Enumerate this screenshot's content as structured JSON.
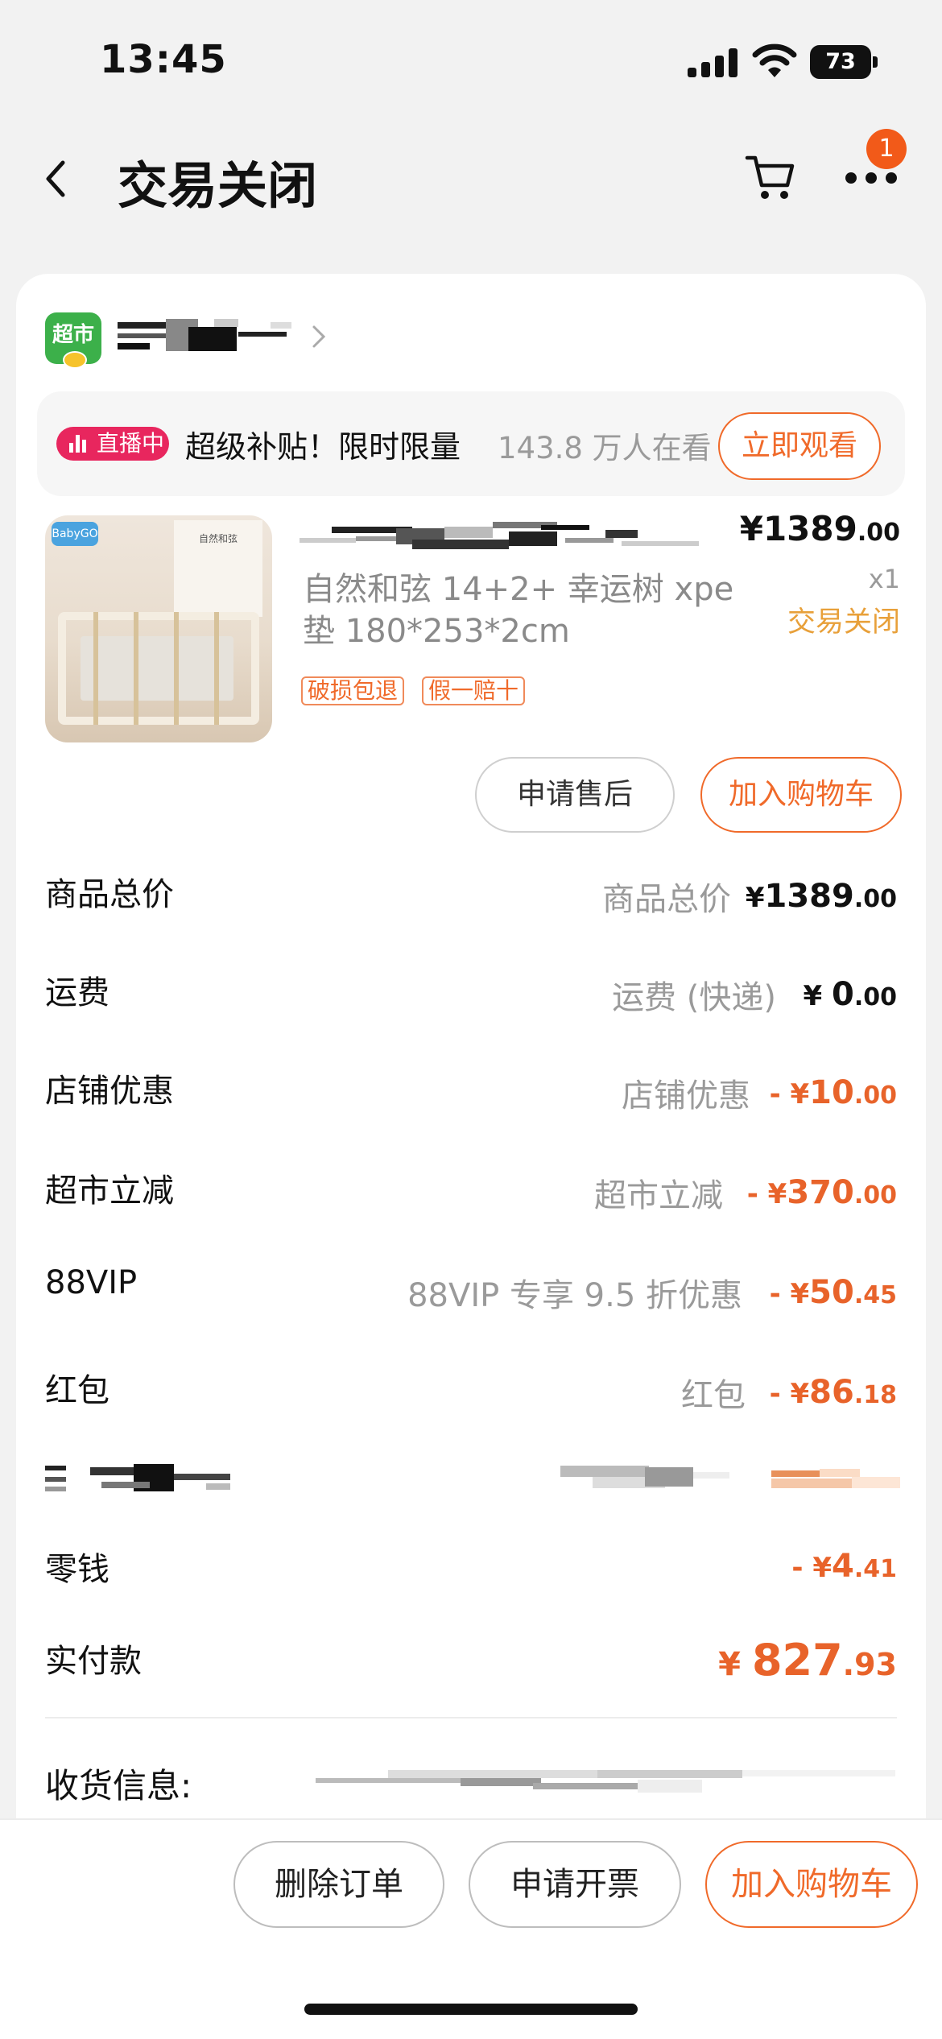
{
  "status_bar": {
    "time": "13:45",
    "battery": "73"
  },
  "nav": {
    "title": "交易关闭",
    "badge_count": "1"
  },
  "shop": {
    "market_logo_text": "超市"
  },
  "live": {
    "badge": "直播中",
    "text": "超级补贴！限时限量",
    "viewers": "143.8 万人在看",
    "watch_button": "立即观看"
  },
  "product": {
    "brand_mark": "BabyGO",
    "image_sign": "自然和弦",
    "desc": "自然和弦 14+2+ 幸运树 xpe 垫 180*253*2cm",
    "tags": [
      "破损包退",
      "假一赔十"
    ],
    "price_symbol": "¥",
    "price_int": "1389",
    "price_dec": ".00",
    "qty": "x1",
    "status": "交易关闭",
    "after_sale_button": "申请售后",
    "add_cart_button": "加入购物车"
  },
  "rows": {
    "total": {
      "label": "商品总价",
      "sub": "商品总价",
      "prefix": "¥",
      "int": "1389",
      "dec": ".00"
    },
    "shipping": {
      "label": "运费",
      "sub": "运费 (快递)",
      "prefix": "¥ ",
      "int": "0",
      "dec": ".00"
    },
    "shop_discount": {
      "label": "店铺优惠",
      "sub": "店铺优惠",
      "prefix": "- ¥",
      "int": "10",
      "dec": ".00"
    },
    "market_discount": {
      "label": "超市立减",
      "sub": "超市立减",
      "prefix": "- ¥",
      "int": "370",
      "dec": ".00"
    },
    "vip": {
      "label": "88VIP",
      "sub": "88VIP 专享 9.5 折优惠",
      "prefix": "- ¥",
      "int": "50",
      "dec": ".45"
    },
    "redpacket": {
      "label": "红包",
      "sub": "红包",
      "prefix": "- ¥",
      "int": "86",
      "dec": ".18"
    },
    "change": {
      "label": "零钱",
      "prefix": "- ¥",
      "int": "4",
      "dec": ".41"
    },
    "paid": {
      "label": "实付款",
      "prefix": "¥ ",
      "int": "827",
      "dec": ".93"
    }
  },
  "address": {
    "label": "收货信息:"
  },
  "bottom": {
    "delete_button": "删除订单",
    "invoice_button": "申请开票",
    "add_cart_button": "加入购物车"
  },
  "colors": {
    "accent": "#f06a2a",
    "live_pink": "#e8265e",
    "status_gold": "#e8a03a",
    "market_green": "#3cb04a"
  }
}
